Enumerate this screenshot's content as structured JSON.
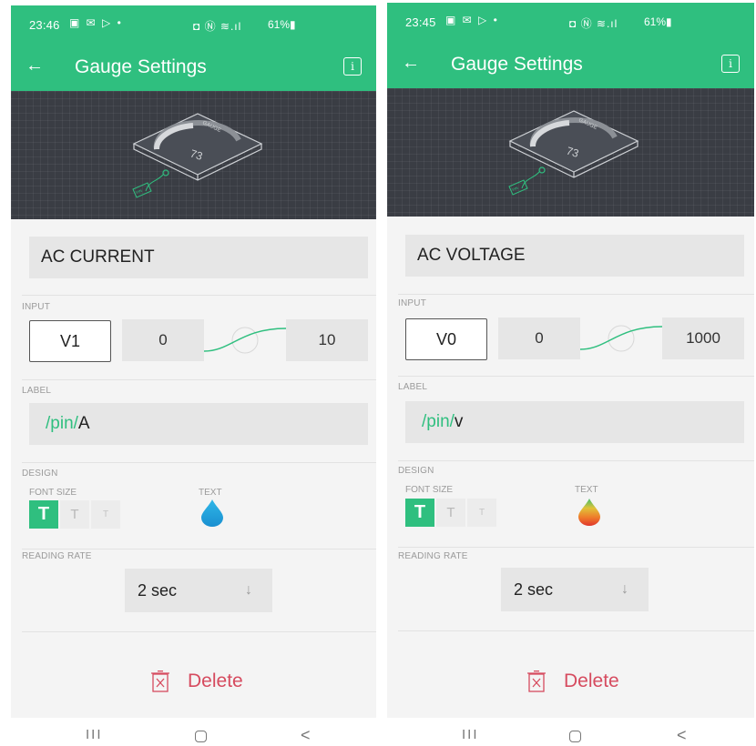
{
  "screens": [
    {
      "status": {
        "time": "23:46",
        "notif": "▣ ✉ ▷ •",
        "sys": "◘ Ⓝ ≋.ıl",
        "battery": "61%▮"
      },
      "appbar": {
        "back": "←",
        "title": "Gauge Settings",
        "info": "i"
      },
      "preview": {
        "gauge_value": "73",
        "gauge_title": "GAUGE",
        "pin_tag": "PIN"
      },
      "name": "AC CURRENT",
      "input": {
        "section": "INPUT",
        "pin": "V1",
        "min": "0",
        "max": "10"
      },
      "label": {
        "section": "LABEL",
        "prefix": "/pin/",
        "suffix": "A"
      },
      "design": {
        "section": "DESIGN",
        "font_size": "FONT SIZE",
        "text": "TEXT",
        "sizes": [
          "T",
          "T",
          "T"
        ],
        "color_style": "blue"
      },
      "reading_rate": {
        "section": "READING RATE",
        "value": "2 sec",
        "arrow": "↓"
      },
      "delete": {
        "label": "Delete"
      },
      "nav": {
        "recent": "III",
        "back": "<"
      }
    },
    {
      "status": {
        "time": "23:45",
        "notif": "▣ ✉ ▷ •",
        "sys": "◘ Ⓝ ≋.ıl",
        "battery": "61%▮"
      },
      "appbar": {
        "back": "←",
        "title": "Gauge Settings",
        "info": "i"
      },
      "preview": {
        "gauge_value": "73",
        "gauge_title": "GAUGE",
        "pin_tag": "PIN"
      },
      "name": "AC VOLTAGE",
      "input": {
        "section": "INPUT",
        "pin": "V0",
        "min": "0",
        "max": "1000"
      },
      "label": {
        "section": "LABEL",
        "prefix": "/pin/",
        "suffix": "v"
      },
      "design": {
        "section": "DESIGN",
        "font_size": "FONT SIZE",
        "text": "TEXT",
        "sizes": [
          "T",
          "T",
          "T"
        ],
        "color_style": "gradient"
      },
      "reading_rate": {
        "section": "READING RATE",
        "value": "2 sec",
        "arrow": "↓"
      },
      "delete": {
        "label": "Delete"
      },
      "nav": {
        "recent": "III",
        "back": "<"
      }
    }
  ],
  "colors": {
    "accent": "#2fbf7f",
    "delete": "#d64b5f",
    "preview_bg": "#3a3d44",
    "field_bg": "#e6e6e6"
  }
}
